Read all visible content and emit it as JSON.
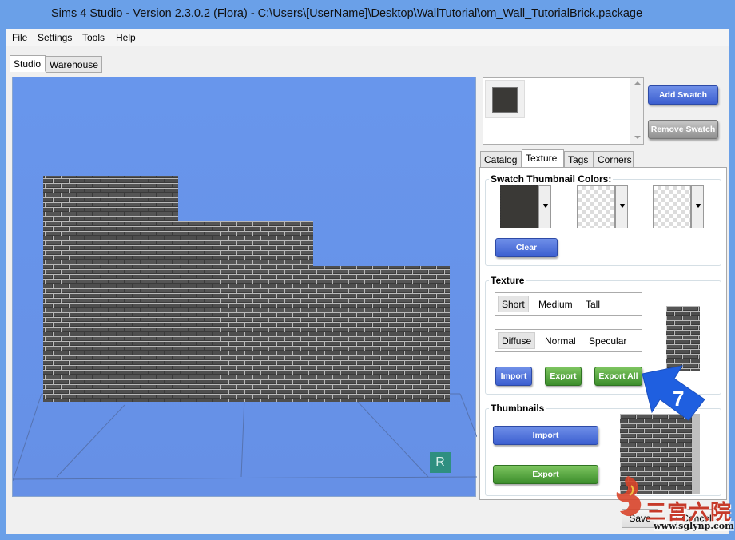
{
  "window": {
    "title": "Sims 4 Studio - Version 2.3.0.2  (Flora)   - C:\\Users\\[UserName]\\Desktop\\WallTutorial\\om_Wall_TutorialBrick.package"
  },
  "menu": [
    "File",
    "Settings",
    "Tools",
    "Help"
  ],
  "main_tabs": [
    "Studio",
    "Warehouse"
  ],
  "viewport": {
    "reset_label": "R"
  },
  "swatch": {
    "add_label": "Add Swatch",
    "remove_label": "Remove Swatch"
  },
  "panel_tabs": [
    "Catalog",
    "Texture",
    "Tags",
    "Corners"
  ],
  "swatch_colors": {
    "title": "Swatch Thumbnail Colors:",
    "clear_label": "Clear",
    "primary_color": "#3a3936"
  },
  "texture": {
    "title": "Texture",
    "sizes": [
      "Short",
      "Medium",
      "Tall"
    ],
    "maps": [
      "Diffuse",
      "Normal",
      "Specular"
    ],
    "import_label": "Import",
    "export_label": "Export",
    "export_all_label": "Export All"
  },
  "thumbnails": {
    "title": "Thumbnails",
    "import_label": "Import",
    "export_label": "Export"
  },
  "annotation": {
    "step": "7",
    "color": "#1f5fe0"
  },
  "footer": {
    "save_label": "Save",
    "cancel_label": "Cancel"
  },
  "watermark": {
    "text": "三宫六院",
    "url": "www.sglynp.com"
  }
}
